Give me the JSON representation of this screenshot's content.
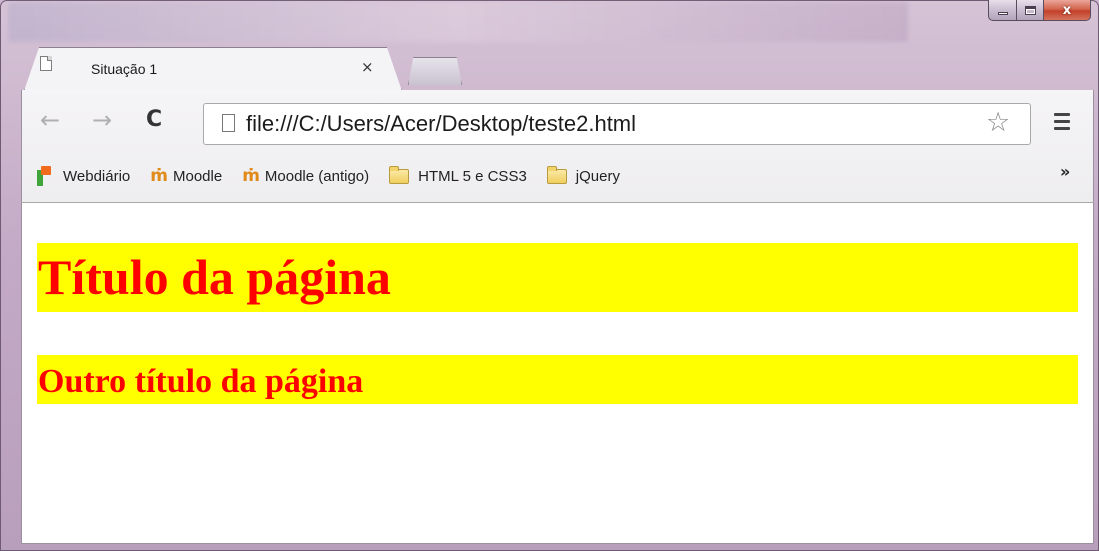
{
  "window": {
    "controls": {
      "minimize": "minimize",
      "maximize": "maximize",
      "close": "x"
    }
  },
  "tabs": [
    {
      "title": "Situação 1",
      "icon": "page-icon",
      "close": "×"
    }
  ],
  "toolbar": {
    "back_icon": "←",
    "forward_icon": "→",
    "reload_icon": "C",
    "url": "file:///C:/Users/Acer/Desktop/teste2.html",
    "star_icon": "☆"
  },
  "bookmarks": {
    "items": [
      {
        "label": "Webdiário",
        "icon": "webdiario-icon"
      },
      {
        "label": "Moodle",
        "icon": "moodle-icon"
      },
      {
        "label": "Moodle (antigo)",
        "icon": "moodle-icon"
      },
      {
        "label": "HTML 5 e CSS3",
        "icon": "folder-icon"
      },
      {
        "label": "jQuery",
        "icon": "folder-icon"
      }
    ],
    "more": "»"
  },
  "page": {
    "heading1": "Título da página",
    "heading2": "Outro título da página",
    "heading_color": "#ff0000",
    "heading_background": "#ffff00"
  }
}
